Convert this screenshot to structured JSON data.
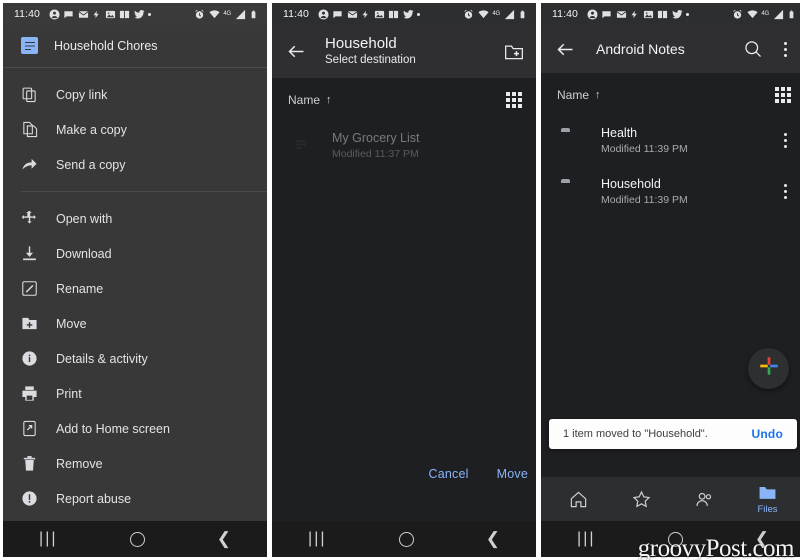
{
  "statusbar": {
    "time": "11:40",
    "left_icons": [
      "account-icon",
      "chat-icon",
      "mail-icon",
      "bolt-icon",
      "photos-icon",
      "book-icon",
      "twitter-icon",
      "dot-icon"
    ],
    "right_icons": [
      "alarm-icon",
      "wifi-icon",
      "4g-label",
      "signal-icon",
      "battery-icon"
    ],
    "network_label": "4G"
  },
  "panel1": {
    "name": "drive-context-menu",
    "file_title": "Household Chores",
    "file_icon": "docs-file-icon",
    "menu": [
      {
        "label": "Copy link",
        "icon": "copy-link-icon"
      },
      {
        "label": "Make a copy",
        "icon": "duplicate-icon"
      },
      {
        "label": "Send a copy",
        "icon": "share-arrow-icon"
      },
      {
        "label": "Open with",
        "icon": "open-with-icon"
      },
      {
        "label": "Download",
        "icon": "download-icon"
      },
      {
        "label": "Rename",
        "icon": "rename-icon"
      },
      {
        "label": "Move",
        "icon": "move-folder-icon"
      },
      {
        "label": "Details & activity",
        "icon": "info-icon"
      },
      {
        "label": "Print",
        "icon": "print-icon"
      },
      {
        "label": "Add to Home screen",
        "icon": "add-to-home-icon"
      },
      {
        "label": "Remove",
        "icon": "trash-icon"
      },
      {
        "label": "Report abuse",
        "icon": "report-abuse-icon"
      }
    ],
    "separator_after_index": 2
  },
  "panel2": {
    "name": "select-destination-screen",
    "back_icon": "back-arrow-icon",
    "title": "Household",
    "subtitle": "Select destination",
    "new_folder_icon": "new-folder-icon",
    "sort_label": "Name",
    "sort_direction": "↑",
    "view_toggle_icon": "grid-view-icon",
    "items": [
      {
        "name": "My Grocery List",
        "modified": "Modified 11:37 PM",
        "icon": "docs-file-icon",
        "dimmed": true
      }
    ],
    "actions": {
      "cancel": "Cancel",
      "confirm": "Move"
    }
  },
  "panel3": {
    "name": "android-notes-folder-screen",
    "back_icon": "back-arrow-icon",
    "title": "Android Notes",
    "search_icon": "search-icon",
    "overflow_icon": "kebab-menu-icon",
    "sort_label": "Name",
    "sort_direction": "↑",
    "view_toggle_icon": "grid-view-icon",
    "items": [
      {
        "name": "Health",
        "modified": "Modified 11:39 PM",
        "icon": "folder-icon",
        "overflow_icon": "kebab-menu-icon"
      },
      {
        "name": "Household",
        "modified": "Modified 11:39 PM",
        "icon": "folder-icon",
        "overflow_icon": "kebab-menu-icon"
      }
    ],
    "fab": {
      "icon": "google-plus-add-icon"
    },
    "snackbar": {
      "message": "1 item moved to \"Household\".",
      "action": "Undo"
    },
    "bottom_nav": [
      {
        "label": "",
        "icon": "home-icon",
        "active": false
      },
      {
        "label": "",
        "icon": "starred-icon",
        "active": false
      },
      {
        "label": "",
        "icon": "shared-icon",
        "active": false
      },
      {
        "label": "Files",
        "icon": "files-icon",
        "active": true
      }
    ]
  },
  "sysnav": {
    "recents_icon": "recents-icon",
    "home_icon": "home-circle-icon",
    "back_icon": "back-chevron-icon"
  },
  "watermark": "groovyPost.com",
  "colors": {
    "panel1_bg": "#383838",
    "panel_bg": "#1e1f22",
    "appbar_bg": "#2f2f31",
    "accent_blue": "#8ab4f8",
    "link_blue": "#1a73e8",
    "text_primary": "#f1f3f4",
    "text_secondary": "#a7abae"
  }
}
